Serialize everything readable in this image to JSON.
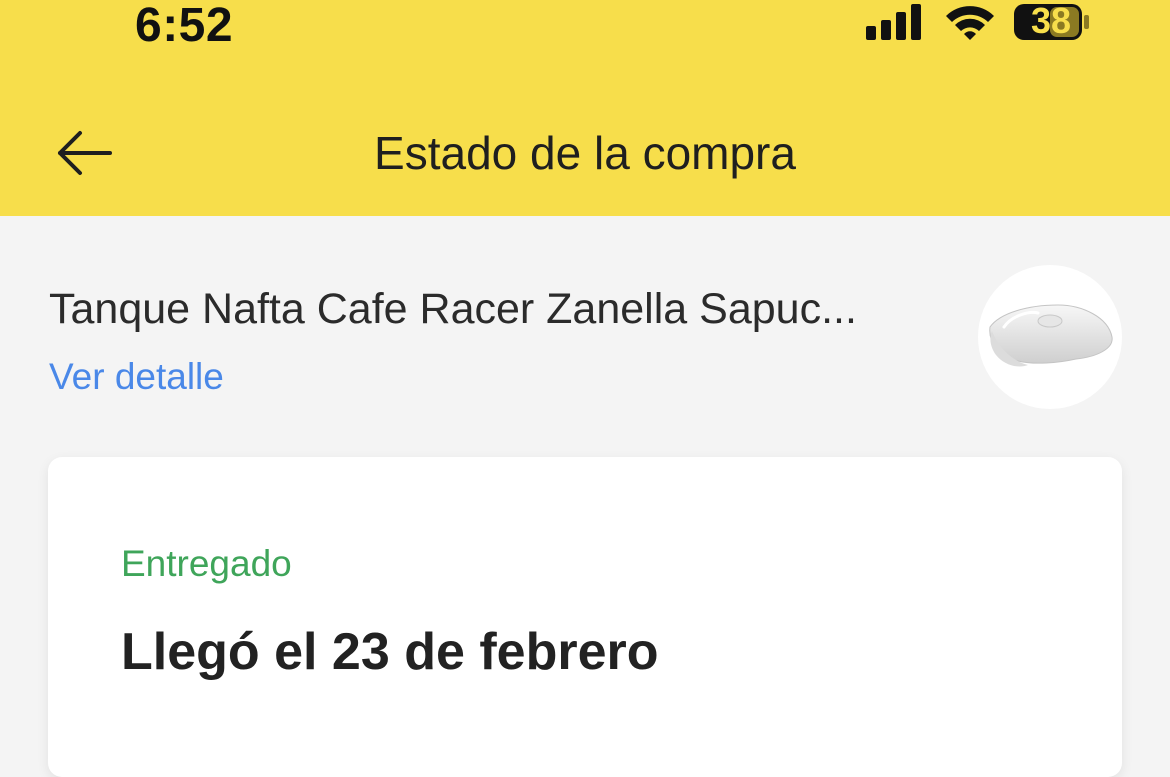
{
  "status_bar": {
    "time": "6:52",
    "battery": "38",
    "icons": [
      "signal-icon",
      "wifi-icon",
      "battery-icon"
    ]
  },
  "header": {
    "title": "Estado de la compra",
    "back_icon": "back-arrow-icon",
    "background_color": "#f7de4b"
  },
  "product": {
    "title": "Tanque Nafta Cafe Racer Zanella Sapuc...",
    "details_link": "Ver detalle"
  },
  "shipment": {
    "status": "Entregado",
    "status_color": "#3fa55a",
    "headline": "Llegó el 23 de febrero"
  },
  "colors": {
    "link": "#4a88e8",
    "page_background": "#f4f4f4"
  }
}
